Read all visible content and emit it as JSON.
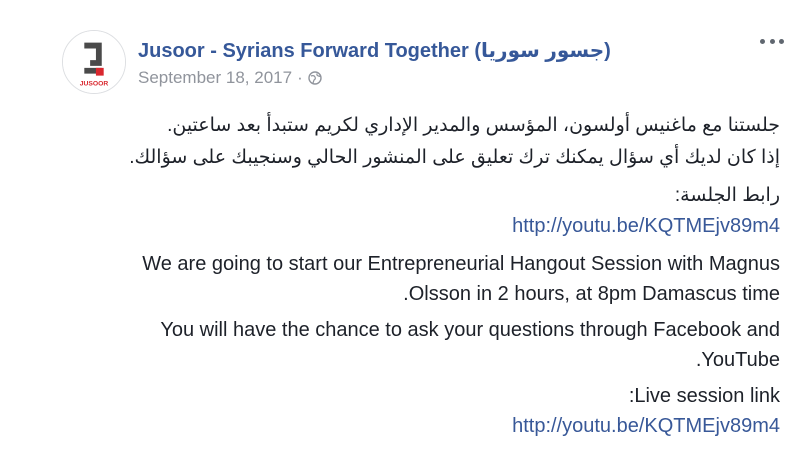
{
  "post": {
    "page_name": "Jusoor - Syrians Forward Together (جسور سوريا)",
    "avatar_text": "JUSOOR",
    "date": "September 18, 2017",
    "separator": "·",
    "privacy_icon": "globe-icon",
    "more_icon": "ellipsis-icon",
    "colors": {
      "name": "#365899",
      "meta": "#90949c",
      "link": "#385898",
      "avatar_red": "#d9272e",
      "avatar_dark": "#4a4a4a"
    }
  },
  "content": {
    "arabic_line1": "جلستنا مع ماغنيس أولسون، المؤسس والمدير الإداري لكريم ستبدأ بعد ساعتين.",
    "arabic_line2": "إذا كان لديك أي سؤال يمكنك ترك تعليق على المنشور الحالي وسنجيبك على سؤالك.",
    "arabic_link_label": "رابط الجلسة:",
    "link1": "http://youtu.be/KQTMEjv89m4",
    "english_p1_line1": "We are going to start our Entrepreneurial Hangout Session with Magnus",
    "english_p1_line2": ".Olsson in 2 hours, at 8pm Damascus time",
    "english_p2_line1": "You will have the chance to ask your questions through Facebook and",
    "english_p2_line2": ".YouTube",
    "english_link_label": ":Live session link",
    "link2": "http://youtu.be/KQTMEjv89m4"
  }
}
